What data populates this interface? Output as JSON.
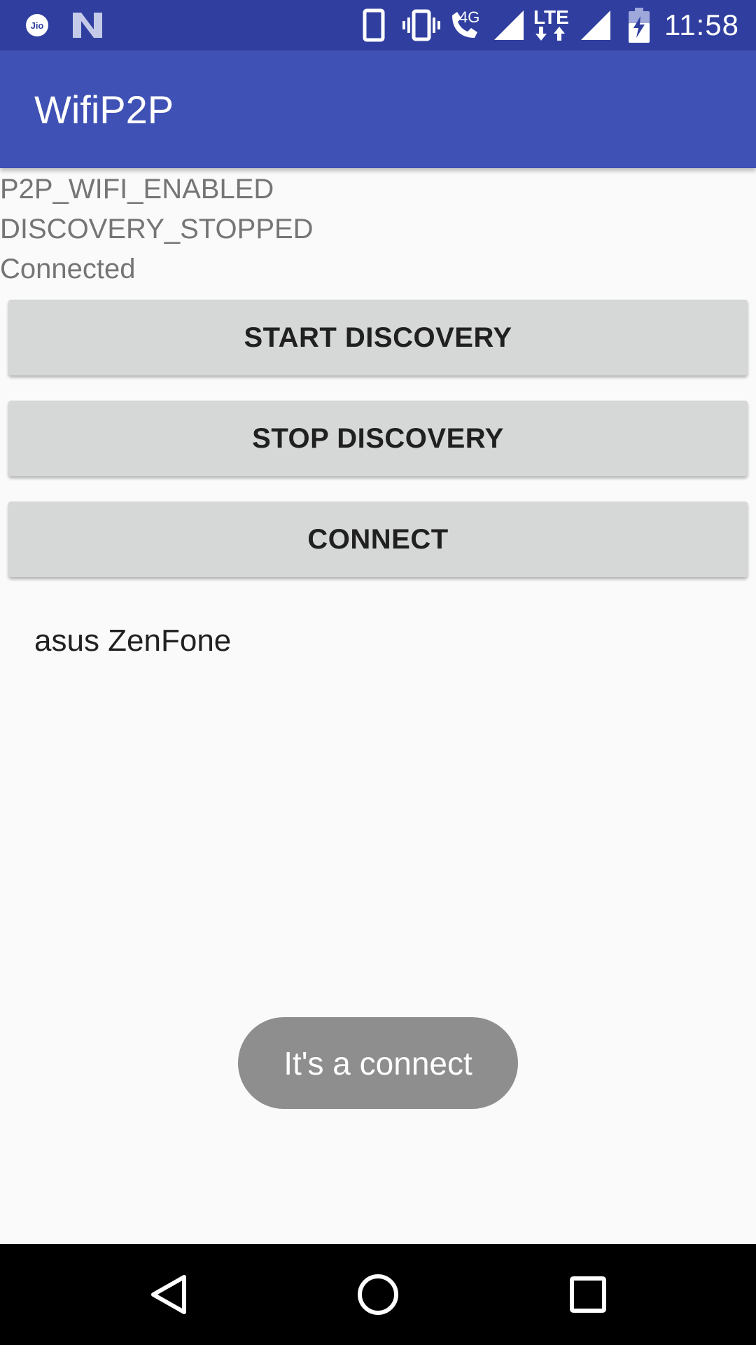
{
  "status_bar": {
    "time": "11:58",
    "network_label": "4G",
    "lte_label": "LTE",
    "carrier_icon": "jio-icon",
    "icons": [
      "jio-icon",
      "n-notification-icon",
      "phone-device-icon",
      "vibrate-icon",
      "volte-call-icon",
      "signal-icon",
      "lte-data-icon",
      "signal-icon",
      "battery-charging-icon"
    ]
  },
  "app_bar": {
    "title": "WifiP2P"
  },
  "status": {
    "wifi_state": "P2P_WIFI_ENABLED",
    "discovery_state": "DISCOVERY_STOPPED",
    "connection_state": "Connected"
  },
  "buttons": {
    "start_discovery": "START DISCOVERY",
    "stop_discovery": "STOP DISCOVERY",
    "connect": "CONNECT"
  },
  "peers": [
    {
      "name": "asus ZenFone"
    }
  ],
  "toast": {
    "message": "It's a connect"
  },
  "nav_bar": {
    "icons": [
      "back-icon",
      "home-icon",
      "recents-icon"
    ]
  },
  "colors": {
    "status_bar": "#303f9f",
    "app_bar": "#3f51b5",
    "button_bg": "#d6d7d7",
    "toast_bg": "#8e8e8e",
    "background": "#fafafa"
  }
}
